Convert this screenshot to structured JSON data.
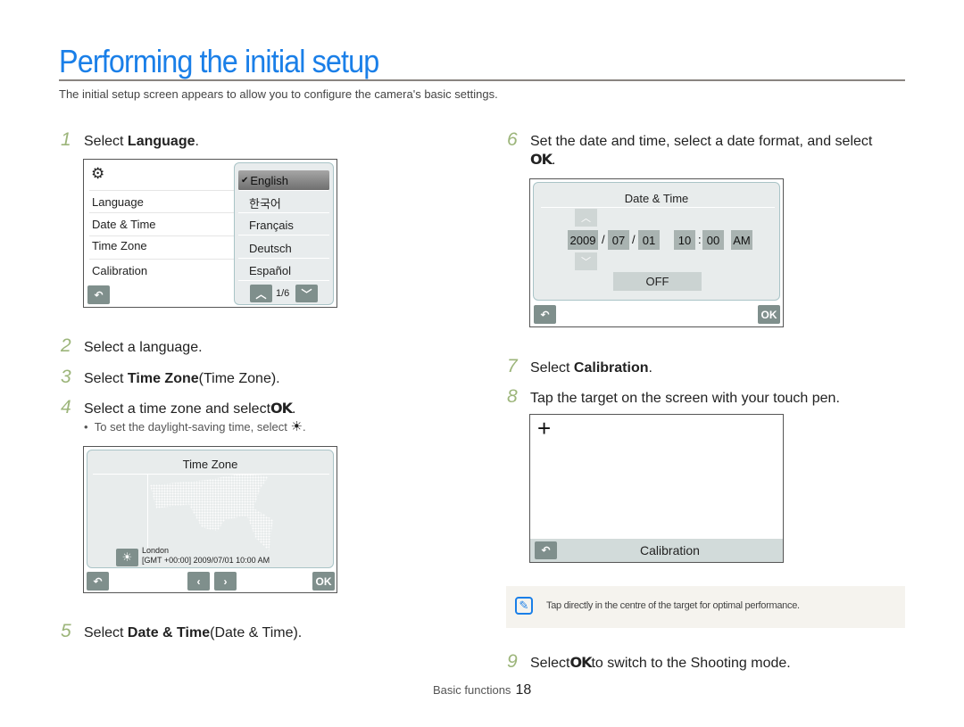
{
  "page": {
    "title": "Performing the initial setup",
    "intro": "The initial setup screen appears to allow you to configure the camera's basic settings."
  },
  "steps": [
    {
      "num": "1",
      "pre": "Select ",
      "bold": "Language",
      "post": "."
    },
    {
      "num": "2",
      "pre": "Select a language.",
      "bold": "",
      "post": ""
    },
    {
      "num": "3",
      "pre": "Select ",
      "bold": "Time Zone",
      "post": " (Time Zone)."
    },
    {
      "num": "4",
      "pre": "Select a time zone and select ",
      "bold": "OK",
      "post": "."
    },
    {
      "num": "5",
      "pre": "Select ",
      "bold": "Date & Time",
      "post": " (Date & Time)."
    },
    {
      "num": "6",
      "pre": "Set the date and time, select a date format, and select",
      "bold": "OK",
      "post": "."
    },
    {
      "num": "7",
      "pre": "Select ",
      "bold": "Calibration",
      "post": "."
    },
    {
      "num": "8",
      "pre": "Tap the target on the screen with your touch pen.",
      "bold": "",
      "post": ""
    },
    {
      "num": "9",
      "pre": "Select ",
      "bold": "OK",
      "post": " to switch to the Shooting mode."
    }
  ],
  "step4_sub": {
    "bullet": "•",
    "text": "To set the daylight-saving time, select",
    "icon": "sun-icon",
    "post": "."
  },
  "language_screen": {
    "header_icon": "gear-icon",
    "menu": [
      "Language",
      "Date & Time",
      "Time Zone",
      "Calibration"
    ],
    "languages": [
      "English",
      "한국어",
      "Français",
      "Deutsch",
      "Español"
    ],
    "selected": "English",
    "check": "✔",
    "page": "1/6",
    "back_icon": "back-icon"
  },
  "timezone_screen": {
    "title": "Time Zone",
    "city": "London",
    "detail": "[GMT +00:00] 2009/07/01 10:00 AM",
    "ok_label": "OK"
  },
  "date_screen": {
    "title": "Date & Time",
    "year": "2009",
    "month": "07",
    "day": "01",
    "hour": "10",
    "minute": "00",
    "ampm": "AM",
    "date_sep": "/",
    "time_sep": ":",
    "format_value": "OFF",
    "ok_label": "OK"
  },
  "calibration_screen": {
    "target": "+",
    "label": "Calibration"
  },
  "note": {
    "icon": "note-icon",
    "text": "Tap directly in the centre of the target for optimal performance."
  },
  "footer": {
    "section": "Basic functions",
    "page": "18"
  },
  "colors": {
    "accent": "#1a7fe8",
    "step_number": "#9cb57a",
    "button_gray": "#7f8f8c"
  }
}
